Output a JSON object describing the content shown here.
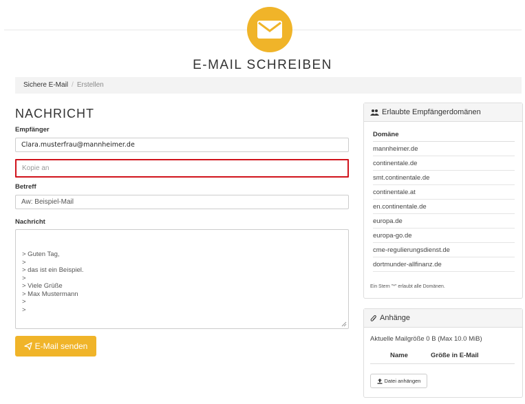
{
  "header": {
    "title": "E-MAIL SCHREIBEN",
    "logo_icon": "envelope-icon",
    "accent_color": "#f0b429"
  },
  "breadcrumb": {
    "items": [
      "Sichere E-Mail",
      "Erstellen"
    ]
  },
  "form": {
    "section_title": "NACHRICHT",
    "recipient_label": "Empfänger",
    "recipient_value": "Clara.musterfrau@mannheimer.de",
    "cc_placeholder": "Kopie an",
    "subject_label": "Betreff",
    "subject_value": "Aw: Beispiel-Mail",
    "message_label": "Nachricht",
    "message_lines": [
      "> Guten Tag,",
      ">",
      "> das ist ein Beispiel.",
      ">",
      "> Viele Grüße",
      "> Max Mustermann",
      ">",
      ">"
    ],
    "send_label": "E-Mail senden",
    "send_icon": "paper-plane-icon"
  },
  "domains_panel": {
    "title": "Erlaubte Empfängerdomänen",
    "icon": "users-icon",
    "column_header": "Domäne",
    "items": [
      "mannheimer.de",
      "continentale.de",
      "smt.continentale.de",
      "continentale.at",
      "en.continentale.de",
      "europa.de",
      "europa-go.de",
      "cme-regulierungsdienst.de",
      "dortmunder-allfinanz.de"
    ],
    "note": "Ein Stern \"*\" erlaubt alle Domänen."
  },
  "attachments_panel": {
    "title": "Anhänge",
    "icon": "paperclip-icon",
    "size_text": "Aktuelle Mailgröße 0 B (Max 10.0 MiB)",
    "columns": [
      "Name",
      "Größe in E-Mail"
    ],
    "attach_button": "Datei anhängen",
    "attach_icon": "upload-icon"
  }
}
